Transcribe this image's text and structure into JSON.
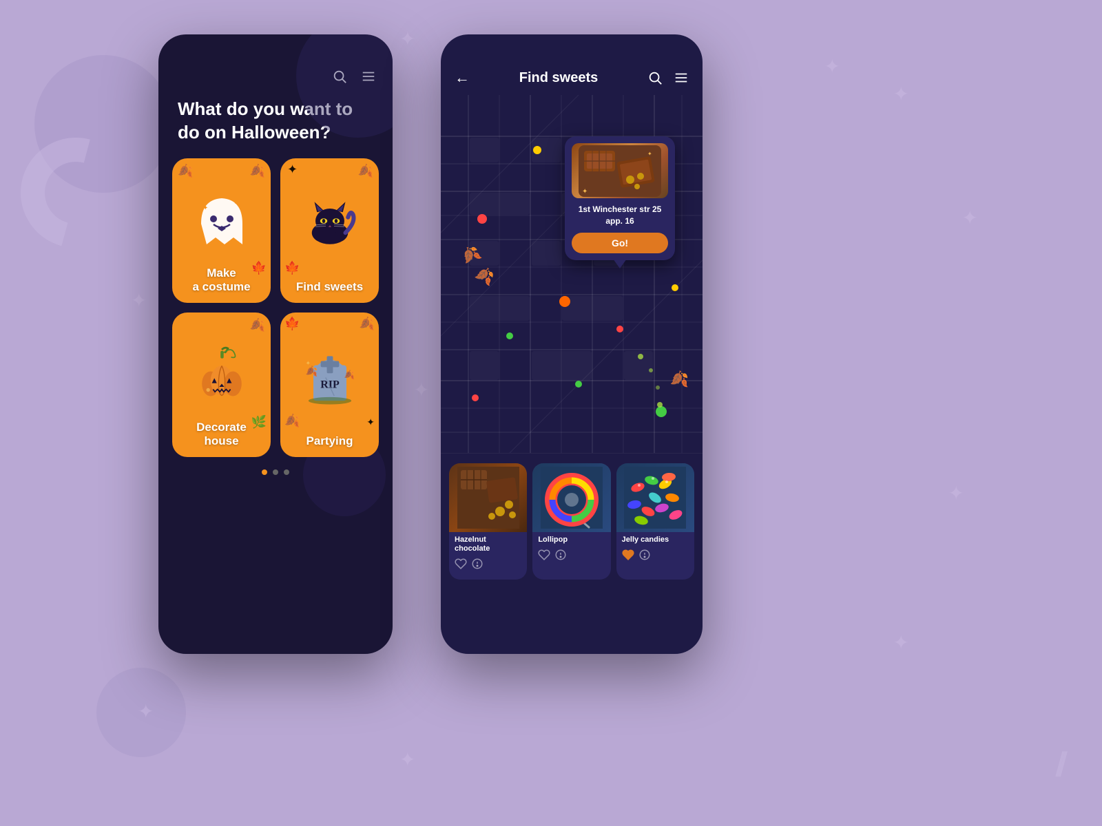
{
  "background": {
    "color": "#b9a8d4"
  },
  "phone_left": {
    "header_icons": [
      "search",
      "menu"
    ],
    "title": "What do you want to do on Halloween?",
    "cards": [
      {
        "id": "make-costume",
        "label": "Make\na costume",
        "emoji": "👻",
        "color": "#f5921e"
      },
      {
        "id": "find-sweets",
        "label": "Find sweets",
        "emoji": "🐱",
        "color": "#f5921e"
      },
      {
        "id": "decorate-house",
        "label": "Decorate\nhouse",
        "emoji": "🎃",
        "color": "#f5921e"
      },
      {
        "id": "partying",
        "label": "Partying",
        "emoji": "🪦",
        "color": "#f5921e"
      }
    ],
    "dots": [
      {
        "active": true
      },
      {
        "active": false
      },
      {
        "active": false
      }
    ]
  },
  "phone_right": {
    "header": {
      "back": "←",
      "title": "Find sweets",
      "icons": [
        "search",
        "menu"
      ]
    },
    "map_popup": {
      "address_line1": "1st Winchester str 25",
      "address_line2": "app. 16",
      "button_label": "Go!"
    },
    "sweets": [
      {
        "name": "Hazelnut\nchocolate",
        "type": "chocolate"
      },
      {
        "name": "Lollipop",
        "type": "lollipop"
      },
      {
        "name": "Jelly candies",
        "type": "jelly"
      }
    ]
  }
}
